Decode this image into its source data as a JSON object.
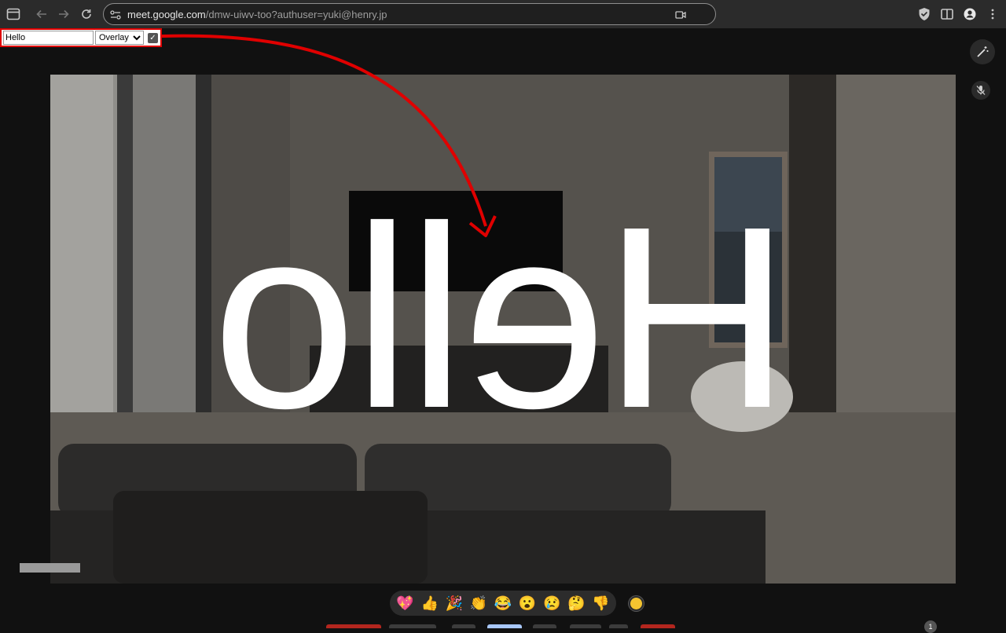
{
  "browser": {
    "url_domain": "meet.google.com",
    "url_path": "/dmw-uiwv-too?authuser=yuki@henry.jp"
  },
  "overlay_controls": {
    "text_value": "Hello",
    "mode_selected": "Overlay",
    "mirror_checked": true
  },
  "video": {
    "overlay_text": "Hello"
  },
  "reactions": {
    "items": [
      {
        "name": "sparkling-heart",
        "glyph": "💖"
      },
      {
        "name": "thumbs-up",
        "glyph": "👍"
      },
      {
        "name": "party-popper",
        "glyph": "🎉"
      },
      {
        "name": "clapping-hands",
        "glyph": "👏"
      },
      {
        "name": "tears-of-joy",
        "glyph": "😂"
      },
      {
        "name": "surprised-face",
        "glyph": "😮"
      },
      {
        "name": "sad-face",
        "glyph": "😢"
      },
      {
        "name": "thinking-face",
        "glyph": "🤔"
      },
      {
        "name": "thumbs-down",
        "glyph": "👎"
      }
    ],
    "skin_tone_color": "#f4c430"
  },
  "notifications": {
    "count": "1"
  },
  "colors": {
    "annotation_red": "#e00000",
    "chrome_bg": "#2b2b2b",
    "page_bg": "#111111"
  }
}
